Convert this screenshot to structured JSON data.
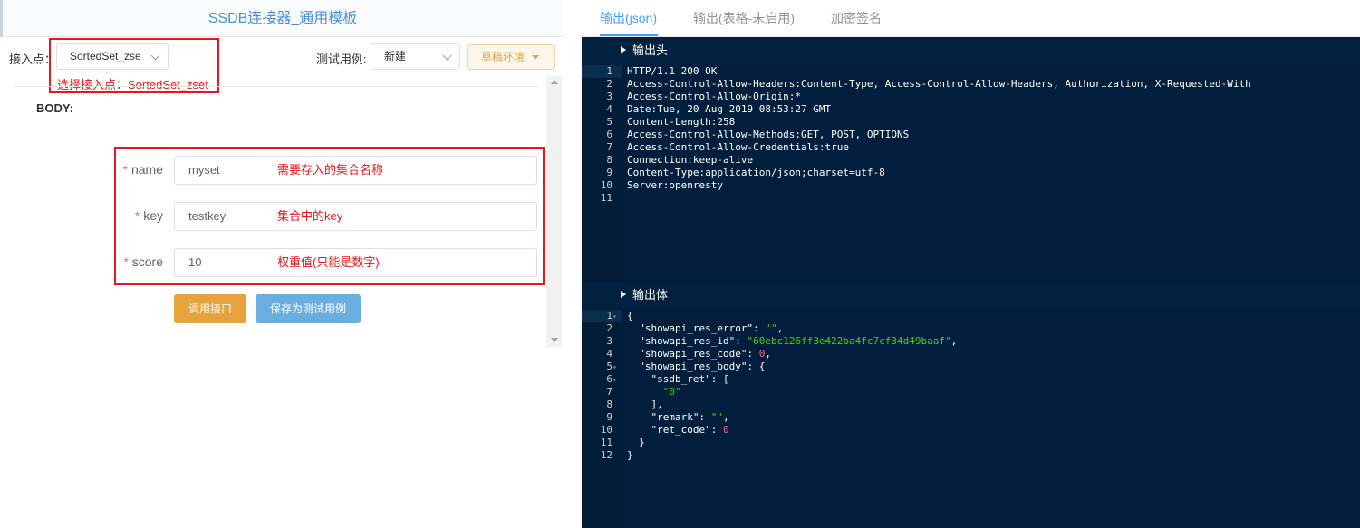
{
  "left_panel": {
    "title": "SSDB连接器_通用模板",
    "endpoint_label": "接入点：",
    "endpoint_value": "SortedSet_zse",
    "endpoint_annotation": "选择接入点：SortedSet_zset",
    "test_case_label": "测试用例:",
    "test_case_value": "新建",
    "env_button": "草稿环境",
    "body_label": "BODY:",
    "fields": [
      {
        "label": "name",
        "value": "myset",
        "note": "需要存入的集合名称"
      },
      {
        "label": "key",
        "value": "testkey",
        "note": "集合中的key"
      },
      {
        "label": "score",
        "value": "10",
        "note": "权重值(只能是数字)"
      }
    ],
    "required_mark": "*",
    "call_button": "调用接口",
    "save_button": "保存为测试用例"
  },
  "right_panel": {
    "tabs": [
      "输出(json)",
      "输出(表格-未启用)",
      "加密签名"
    ],
    "active_tab": 0,
    "header_section": {
      "title": "输出头",
      "lines": [
        "HTTP/1.1 200 OK",
        "Access-Control-Allow-Headers:Content-Type, Access-Control-Allow-Headers, Authorization, X-Requested-With",
        "Access-Control-Allow-Origin:*",
        "Date:Tue, 20 Aug 2019 08:53:27 GMT",
        "Content-Length:258",
        "Access-Control-Allow-Methods:GET, POST, OPTIONS",
        "Access-Control-Allow-Credentials:true",
        "Connection:keep-alive",
        "Content-Type:application/json;charset=utf-8",
        "Server:openresty",
        ""
      ]
    },
    "body_section": {
      "title": "输出体",
      "lines": [
        "{",
        "  \"showapi_res_error\": \"\",",
        "  \"showapi_res_id\": \"60ebc126ff3e422ba4fc7cf34d49baaf\",",
        "  \"showapi_res_code\": 0,",
        "  \"showapi_res_body\": {",
        "    \"ssdb_ret\": [",
        "      \"0\"",
        "    ],",
        "    \"remark\": \"\",",
        "    \"ret_code\": 0",
        "  }",
        "}"
      ],
      "fold_lines": [
        1,
        5,
        6
      ]
    }
  },
  "colors": {
    "annotation_red": "#e3191f",
    "editor_bg": "#02213f",
    "accent_blue": "#409eff",
    "string_green": "#3ad900",
    "number_pink": "#ff628c",
    "warning_orange": "#e6a23c"
  },
  "icons": {
    "endpoint_select": "chevron-down-icon",
    "test_case_select": "chevron-down-icon",
    "env_button": "caret-down-icon",
    "section_toggle": "triangle-right-icon"
  }
}
